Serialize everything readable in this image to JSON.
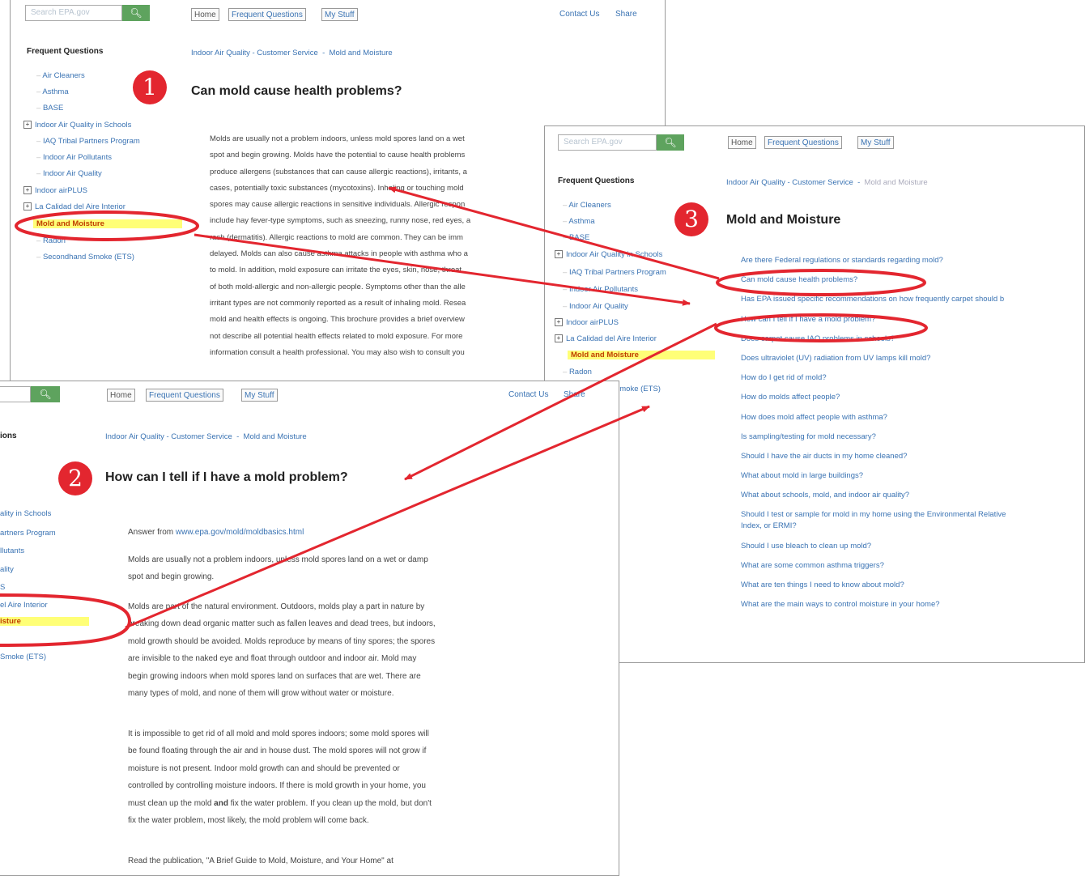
{
  "common": {
    "search_placeholder": "Search EPA.gov",
    "tabs": [
      "Home",
      "Frequent Questions",
      "My Stuff"
    ],
    "contact": "Contact Us",
    "share": "Share",
    "sidebar_title": "Frequent Questions"
  },
  "panel1": {
    "breadcrumb": [
      "Indoor Air Quality - Customer Service",
      "Mold and Moisture"
    ],
    "badge": "1",
    "title": "Can mold cause health problems?",
    "sidebar": [
      "Air Cleaners",
      "Asthma",
      "BASE",
      "Indoor Air Quality in Schools",
      "IAQ Tribal Partners Program",
      "Indoor Air Pollutants",
      "Indoor Air Quality",
      "Indoor airPLUS",
      "La Calidad del Aire Interior",
      "Mold and Moisture",
      "Radon",
      "Secondhand Smoke (ETS)"
    ],
    "body_lines": [
      "Molds are usually not a problem indoors, unless mold spores land on a wet",
      "spot and begin growing.  Molds have the potential to cause health problems",
      "produce allergens (substances that can cause allergic reactions), irritants, a",
      "cases, potentially toxic substances (mycotoxins).  Inhaling or touching mold",
      "spores may cause allergic reactions in sensitive individuals.  Allergic respon",
      "include hay fever-type symptoms, such as sneezing, runny nose, red eyes, a",
      "rash (dermatitis).  Allergic reactions to mold are common.  They can be imm",
      "delayed.  Molds can also cause asthma attacks in people with asthma who a",
      "to mold.  In addition, mold exposure can irritate the eyes, skin, nose, throat",
      "of both mold-allergic and non-allergic people.  Symptoms other than the alle",
      "irritant types are not commonly reported as a result of inhaling mold.  Resea",
      "mold and health effects is ongoing.  This brochure provides a brief overview",
      "not describe all potential health effects related to mold exposure.  For more",
      "information consult a health professional.  You may also wish to consult you"
    ]
  },
  "panel2": {
    "breadcrumb": [
      "Indoor Air Quality - Customer Service",
      "Mold and Moisture"
    ],
    "badge": "2",
    "title": "How can I tell if I have a mold problem?",
    "sidebar_head": "ions",
    "sidebar": [
      "ality in Schools",
      "artners Program",
      "llutants",
      "ality",
      "S",
      "el Aire Interior",
      "isture",
      "",
      "Smoke (ETS)"
    ],
    "answer_label": "Answer from ",
    "answer_link": "www.epa.gov/mold/moldbasics.html",
    "para1": [
      "Molds are usually not a problem indoors, unless mold spores land on a wet or damp",
      "spot and begin growing."
    ],
    "para2": [
      "Molds are part of the natural environment.  Outdoors, molds play a part in nature by",
      "breaking down dead organic matter such as fallen leaves and dead trees, but indoors,",
      "mold growth should be avoided.  Molds reproduce by means of tiny spores; the spores",
      "are invisible to the naked eye and float through outdoor and indoor air.  Mold may",
      "begin growing indoors when mold spores land on surfaces that are wet.  There are",
      "many types of mold, and none of them will grow without water or moisture."
    ],
    "para3": [
      "It is impossible to get rid of all mold and mold spores indoors; some mold spores will",
      "be found floating through the air and in house dust.  The mold spores will not grow if",
      "moisture is not present.  Indoor mold growth can and should be prevented or",
      "controlled by controlling moisture indoors.  If there is mold growth in your home, you"
    ],
    "para3_l5_a": "must clean up the mold ",
    "para3_l5_b": "and",
    "para3_l5_c": " fix the water problem.  If you clean up the mold, but don't",
    "para3_l6": "fix the water problem, most likely, the mold problem will come back.",
    "para4": "Read the publication, \"A Brief Guide to Mold, Moisture, and Your Home\" at"
  },
  "panel3": {
    "breadcrumb": [
      "Indoor Air Quality - Customer Service",
      "Mold and Moisture"
    ],
    "badge": "3",
    "title": "Mold and Moisture",
    "sidebar": [
      "Air Cleaners",
      "Asthma",
      "BASE",
      "Indoor Air Quality in Schools",
      "IAQ Tribal Partners Program",
      "Indoor Air Pollutants",
      "Indoor Air Quality",
      "Indoor airPLUS",
      "La Calidad del Aire Interior",
      "Mold and Moisture",
      "Radon",
      "Secondhand Smoke (ETS)"
    ],
    "questions": [
      "Are there Federal regulations or standards regarding mold?",
      "Can mold cause health problems?",
      "Has EPA issued specific recommendations on how frequently carpet should b",
      "How can I tell if I have a mold problem?",
      "Does carpet cause IAQ problems in schools?",
      "Does ultraviolet (UV) radiation from UV lamps kill mold?",
      "How do I get rid of mold?",
      "How do molds affect people?",
      "How does mold affect people with asthma?",
      "Is sampling/testing for mold necessary?",
      "Should I have the air ducts in my home cleaned?",
      "What about mold in large buildings?",
      "What about schools, mold, and indoor air quality?",
      "Should I test or sample for mold in my home using the Environmental Relative",
      "Index, or ERMI?",
      "Should I use bleach to clean up mold?",
      "What are some common asthma triggers?",
      "What are ten things I need to know about mold?",
      "What are the main ways to control moisture in your home?"
    ]
  },
  "colors": {
    "highlight": "#ffff77",
    "annotation_red": "#e3262f",
    "link": "#3a73b3",
    "search_button": "#5ea35e"
  },
  "icons": [
    "search-icon",
    "expand-icon"
  ]
}
